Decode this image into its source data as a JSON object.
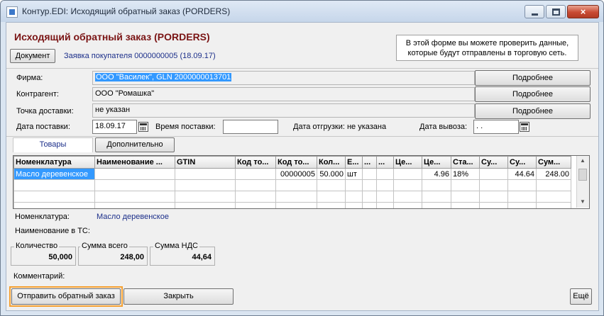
{
  "window": {
    "title": "Контур.EDI: Исходящий обратный заказ (PORDERS)",
    "close_glyph": "×"
  },
  "form": {
    "heading": "Исходящий обратный заказ (PORDERS)",
    "document_button": "Документ",
    "request_link": "Заявка покупателя 0000000005 (18.09.17)",
    "info_text": "В этой форме вы можете проверить данные, которые будут отправлены в торговую сеть."
  },
  "fields": {
    "firm_label": "Фирма:",
    "firm_value": "ООО \"Василек\", GLN 2000000013701",
    "contractor_label": "Контрагент:",
    "contractor_value": "ООО \"Ромашка\"",
    "delivery_point_label": "Точка доставки:",
    "delivery_point_value": "не указан",
    "details_label": "Подробнее",
    "delivery_date_label": "Дата поставки:",
    "delivery_date_value": "18.09.17",
    "delivery_time_label": "Время поставки:",
    "delivery_time_value": "",
    "shipment_date_text": "Дата отгрузки: не указана",
    "pickup_date_label": "Дата вывоза:",
    "pickup_date_value": " .  ."
  },
  "tabs": {
    "goods": "Товары",
    "additional": "Дополнительно"
  },
  "grid": {
    "columns": [
      "Номенклатура",
      "Наименование ...",
      "GTIN",
      "Код то...",
      "Код то...",
      "Кол...",
      "Е...",
      "...",
      "...",
      "Це...",
      "Це...",
      "Ста...",
      "Су...",
      "Су...",
      "Сум..."
    ],
    "rows": [
      [
        "Масло деревенское",
        "",
        "",
        "",
        "00000005",
        "50.000",
        "шт",
        "",
        "",
        "",
        "4.96",
        "18%",
        "",
        "44.64",
        "248.00"
      ]
    ]
  },
  "details": {
    "nomenclature_label": "Номенклатура:",
    "nomenclature_value": "Масло деревенское",
    "ts_name_label": "Наименование в ТС:",
    "ts_name_value": ""
  },
  "totals": {
    "quantity_caption": "Количество",
    "quantity_value": "50,000",
    "sum_caption": "Сумма всего",
    "sum_value": "248,00",
    "vat_caption": "Сумма НДС",
    "vat_value": "44,64"
  },
  "comment_label": "Комментарий:",
  "buttons": {
    "send": "Отправить обратный заказ",
    "close": "Закрыть",
    "more": "Ещё"
  }
}
